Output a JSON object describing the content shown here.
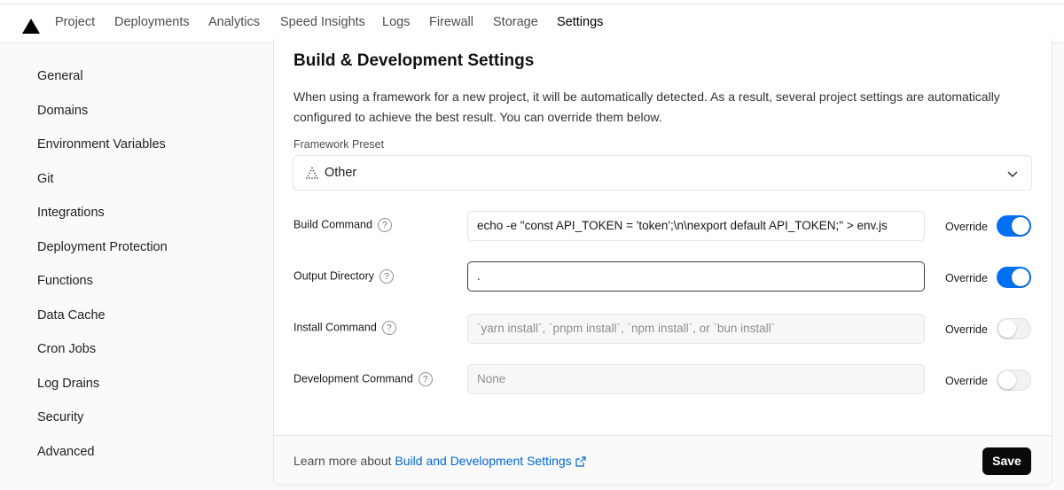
{
  "nav": {
    "logo": "vercel-triangle-logo",
    "tabs": [
      {
        "label": "Project"
      },
      {
        "label": "Deployments"
      },
      {
        "label": "Analytics"
      },
      {
        "label": "Speed Insights"
      },
      {
        "label": "Logs"
      },
      {
        "label": "Firewall"
      },
      {
        "label": "Storage"
      },
      {
        "label": "Settings"
      }
    ],
    "active_tab": "Settings"
  },
  "sidebar": {
    "items": [
      {
        "label": "General"
      },
      {
        "label": "Domains"
      },
      {
        "label": "Environment Variables"
      },
      {
        "label": "Git"
      },
      {
        "label": "Integrations"
      },
      {
        "label": "Deployment Protection"
      },
      {
        "label": "Functions"
      },
      {
        "label": "Data Cache"
      },
      {
        "label": "Cron Jobs"
      },
      {
        "label": "Log Drains"
      },
      {
        "label": "Security"
      },
      {
        "label": "Advanced"
      }
    ]
  },
  "main": {
    "title": "Build & Development Settings",
    "description": "When using a framework for a new project, it will be automatically detected. As a result, several project settings are automatically configured to achieve the best result. You can override them below.",
    "framework_preset": {
      "label": "Framework Preset",
      "value": "Other",
      "icon": "dotted-triangle-icon"
    },
    "rows": [
      {
        "label": "Build Command",
        "value": "echo -e  \"const API_TOKEN = 'token';\\n\\nexport default API_TOKEN;\" > env.js",
        "placeholder": "",
        "override_label": "Override",
        "override_on": true
      },
      {
        "label": "Output Directory",
        "value": ".",
        "placeholder": "",
        "override_label": "Override",
        "override_on": true
      },
      {
        "label": "Install Command",
        "value": "",
        "placeholder": "`yarn install`, `pnpm install`, `npm install`, or `bun install`",
        "override_label": "Override",
        "override_on": false
      },
      {
        "label": "Development Command",
        "value": "",
        "placeholder": "None",
        "override_label": "Override",
        "override_on": false
      }
    ],
    "help_glyph": "?"
  },
  "footer": {
    "text": "Learn more about",
    "link": "Build and Development Settings",
    "save_label": "Save"
  },
  "colors": {
    "accent": "#0070f3",
    "link": "#0068d6",
    "save_bg": "#0a0a0a"
  }
}
